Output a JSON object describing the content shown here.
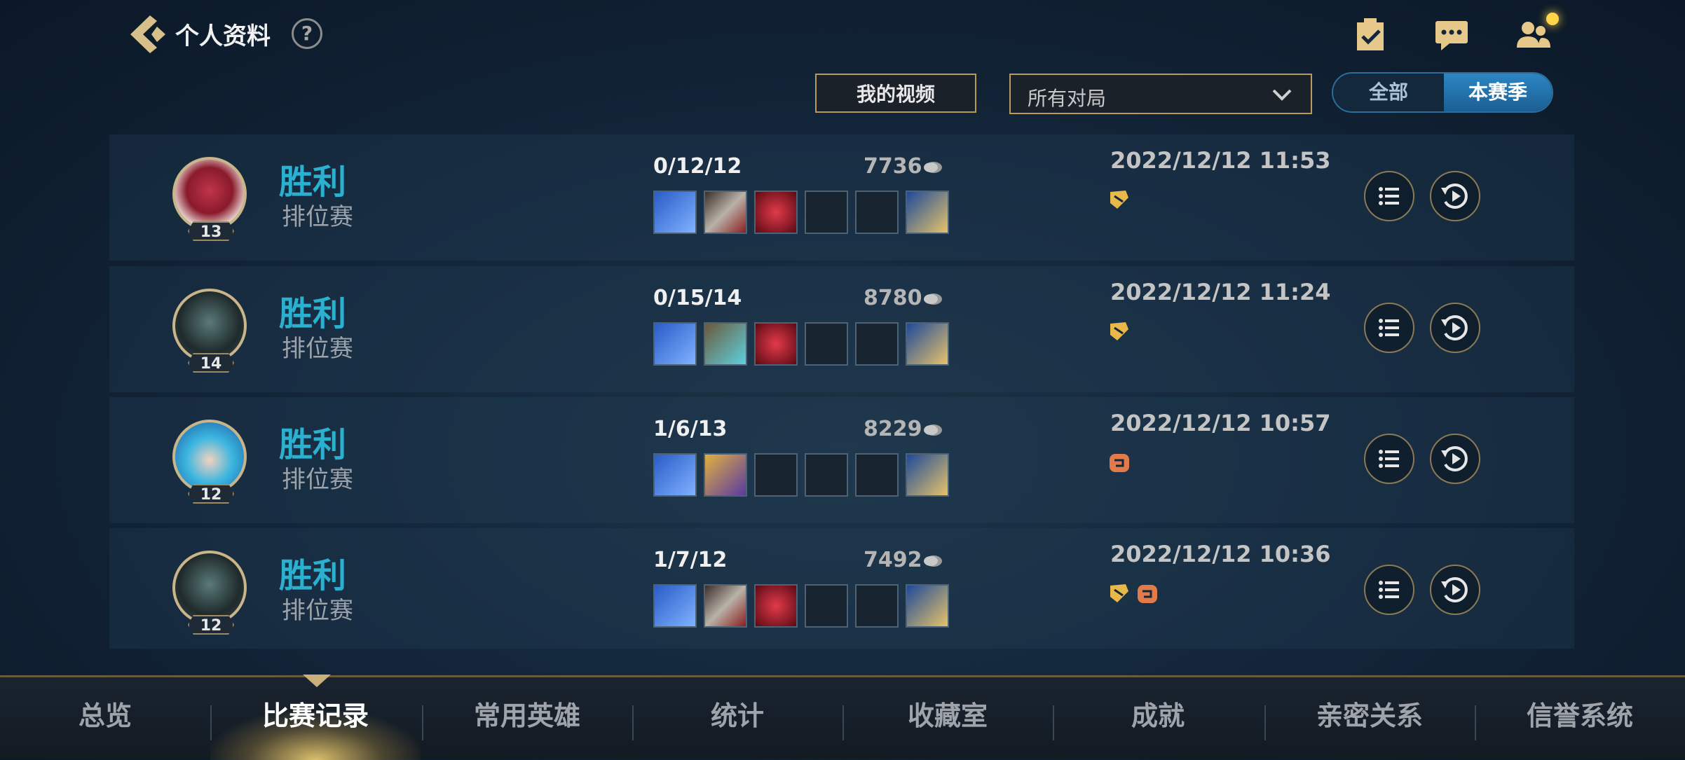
{
  "header": {
    "title": "个人资料",
    "help_label": "?"
  },
  "filters": {
    "video_button": "我的视频",
    "dropdown_value": "所有对局",
    "segments": [
      "全部",
      "本赛季"
    ],
    "selected_segment": "本赛季"
  },
  "matches": [
    {
      "level": "13",
      "result": "胜利",
      "mode": "排位赛",
      "kda": "0/12/12",
      "gold": "7736",
      "datetime": "2022/12/12 11:53"
    },
    {
      "level": "14",
      "result": "胜利",
      "mode": "排位赛",
      "kda": "0/15/14",
      "gold": "8780",
      "datetime": "2022/12/12 11:24"
    },
    {
      "level": "12",
      "result": "胜利",
      "mode": "排位赛",
      "kda": "1/6/13",
      "gold": "8229",
      "datetime": "2022/12/12 10:57"
    },
    {
      "level": "12",
      "result": "胜利",
      "mode": "排位赛",
      "kda": "1/7/12",
      "gold": "7492",
      "datetime": "2022/12/12 10:36"
    }
  ],
  "nav": {
    "items": [
      "总览",
      "比赛记录",
      "常用英雄",
      "统计",
      "收藏室",
      "成就",
      "亲密关系",
      "信誉系统"
    ],
    "active": "比赛记录"
  },
  "colors": {
    "accent_gold": "#b89a5b",
    "victory_blue": "#2bb0cf",
    "segment_active": "#2d86c4"
  }
}
